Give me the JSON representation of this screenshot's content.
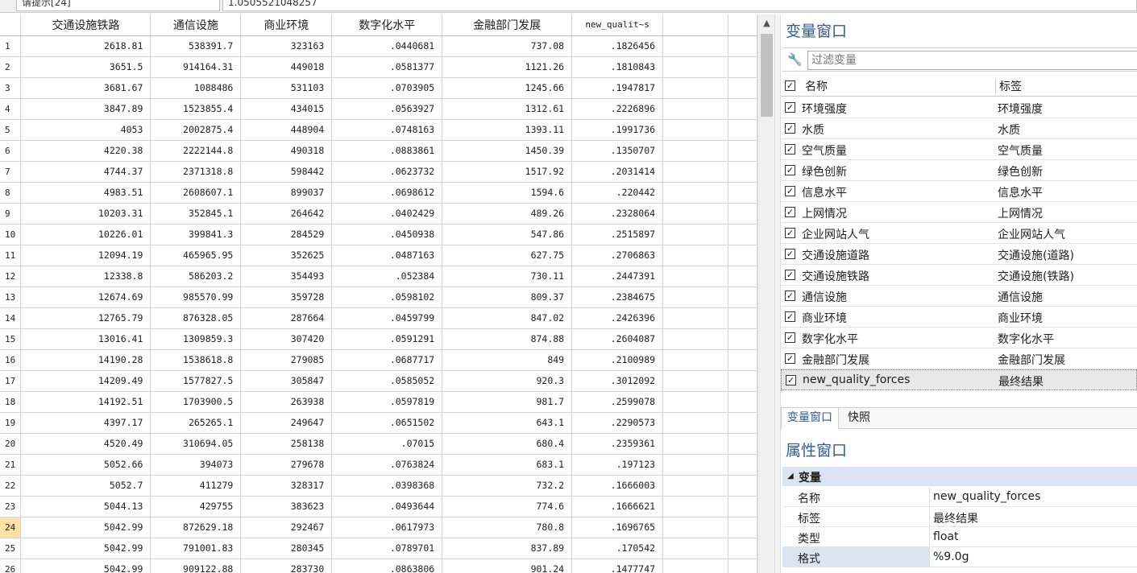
{
  "topbar": {
    "left_value": "请提示[24]",
    "right_value": "1.0505521048257"
  },
  "grid": {
    "columns": [
      "交通设施铁路",
      "通信设施",
      "商业环境",
      "数字化水平",
      "金融部门发展",
      "new_qualit~s"
    ],
    "selected_row": 24,
    "rows": [
      [
        "1",
        "2618.81",
        "538391.7",
        "323163",
        ".0440681",
        "737.08",
        ".1826456"
      ],
      [
        "2",
        "3651.5",
        "914164.31",
        "449018",
        ".0581377",
        "1121.26",
        ".1810843"
      ],
      [
        "3",
        "3681.67",
        "1088486",
        "531103",
        ".0703905",
        "1245.66",
        ".1947817"
      ],
      [
        "4",
        "3847.89",
        "1523855.4",
        "434015",
        ".0563927",
        "1312.61",
        ".2226896"
      ],
      [
        "5",
        "4053",
        "2002875.4",
        "448904",
        ".0748163",
        "1393.11",
        ".1991736"
      ],
      [
        "6",
        "4220.38",
        "2222144.8",
        "490318",
        ".0883861",
        "1450.39",
        ".1350707"
      ],
      [
        "7",
        "4744.37",
        "2371318.8",
        "598442",
        ".0623732",
        "1517.92",
        ".2031414"
      ],
      [
        "8",
        "4983.51",
        "2608607.1",
        "899037",
        ".0698612",
        "1594.6",
        ".220442"
      ],
      [
        "9",
        "10203.31",
        "352845.1",
        "264642",
        ".0402429",
        "489.26",
        ".2328064"
      ],
      [
        "10",
        "10226.01",
        "399841.3",
        "284529",
        ".0450938",
        "547.86",
        ".2515897"
      ],
      [
        "11",
        "12094.19",
        "465965.95",
        "352625",
        ".0487163",
        "627.75",
        ".2706863"
      ],
      [
        "12",
        "12338.8",
        "586203.2",
        "354493",
        ".052384",
        "730.11",
        ".2447391"
      ],
      [
        "13",
        "12674.69",
        "985570.99",
        "359728",
        ".0598102",
        "809.37",
        ".2384675"
      ],
      [
        "14",
        "12765.79",
        "876328.05",
        "287664",
        ".0459799",
        "847.02",
        ".2426396"
      ],
      [
        "15",
        "13016.41",
        "1309859.3",
        "307420",
        ".0591291",
        "874.88",
        ".2604087"
      ],
      [
        "16",
        "14190.28",
        "1538618.8",
        "279085",
        ".0687717",
        "849",
        ".2100989"
      ],
      [
        "17",
        "14209.49",
        "1577827.5",
        "305847",
        ".0585052",
        "920.3",
        ".3012092"
      ],
      [
        "18",
        "14192.51",
        "1703900.5",
        "263938",
        ".0597819",
        "981.7",
        ".2599078"
      ],
      [
        "19",
        "4397.17",
        "265265.1",
        "249647",
        ".0651502",
        "643.1",
        ".2290573"
      ],
      [
        "20",
        "4520.49",
        "310694.05",
        "258138",
        ".07015",
        "680.4",
        ".2359361"
      ],
      [
        "21",
        "5052.66",
        "394073",
        "279678",
        ".0763824",
        "683.1",
        ".197123"
      ],
      [
        "22",
        "5052.7",
        "411279",
        "328317",
        ".0398368",
        "732.2",
        ".1666003"
      ],
      [
        "23",
        "5044.13",
        "429755",
        "383623",
        ".0493644",
        "774.6",
        ".1666621"
      ],
      [
        "24",
        "5042.99",
        "872629.18",
        "292467",
        ".0617973",
        "780.8",
        ".1696765"
      ],
      [
        "25",
        "5042.99",
        "791001.83",
        "280345",
        ".0789701",
        "837.89",
        ".170542"
      ],
      [
        "26",
        "5042.99",
        "909122.88",
        "283730",
        ".0863806",
        "901.24",
        ".1477747"
      ]
    ]
  },
  "var_window": {
    "title": "变量窗口",
    "filter_placeholder": "过滤变量",
    "col_name": "名称",
    "col_label": "标签",
    "variables": [
      {
        "name": "环境强度",
        "label": "环境强度"
      },
      {
        "name": "水质",
        "label": "水质"
      },
      {
        "name": "空气质量",
        "label": "空气质量"
      },
      {
        "name": "绿色创新",
        "label": "绿色创新"
      },
      {
        "name": "信息水平",
        "label": "信息水平"
      },
      {
        "name": "上网情况",
        "label": "上网情况"
      },
      {
        "name": "企业网站人气",
        "label": "企业网站人气"
      },
      {
        "name": "交通设施道路",
        "label": "交通设施(道路)"
      },
      {
        "name": "交通设施铁路",
        "label": "交通设施(铁路)"
      },
      {
        "name": "通信设施",
        "label": "通信设施"
      },
      {
        "name": "商业环境",
        "label": "商业环境"
      },
      {
        "name": "数字化水平",
        "label": "数字化水平"
      },
      {
        "name": "金融部门发展",
        "label": "金融部门发展"
      },
      {
        "name": "new_quality_forces",
        "label": "最终结果"
      }
    ]
  },
  "tabs": [
    "变量窗口",
    "快照"
  ],
  "properties": {
    "title": "属性窗口",
    "section": "变量",
    "items": [
      {
        "key": "名称",
        "value": "new_quality_forces"
      },
      {
        "key": "标签",
        "value": "最终结果"
      },
      {
        "key": "类型",
        "value": "float"
      },
      {
        "key": "格式",
        "value": "%9.0g"
      }
    ]
  }
}
